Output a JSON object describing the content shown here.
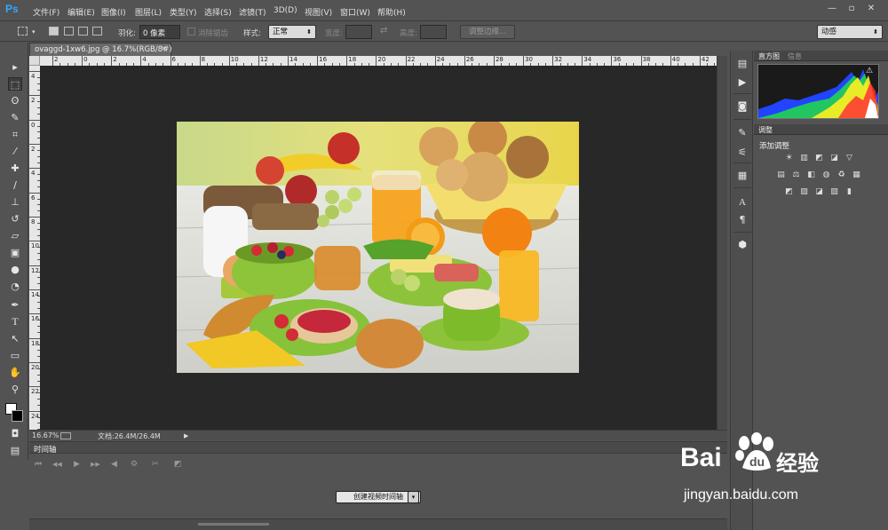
{
  "app": {
    "logo": "Ps"
  },
  "menu": [
    "文件(F)",
    "编辑(E)",
    "图像(I)",
    "图层(L)",
    "类型(Y)",
    "选择(S)",
    "滤镜(T)",
    "3D(D)",
    "视图(V)",
    "窗口(W)",
    "帮助(H)"
  ],
  "window_controls": {
    "minimize": "—",
    "restore": "▫",
    "close": "✕"
  },
  "options": {
    "feather_label": "羽化:",
    "feather_value": "0 像素",
    "antialias_label": "消除锯齿",
    "style_label": "样式:",
    "style_value": "正常",
    "width_label": "宽度:",
    "height_label": "高度:",
    "refine_edge": "调整边缘...",
    "workspace": "动感"
  },
  "document": {
    "tab_title": "ovaggd-1xw6.jpg @ 16.7%(RGB/8#)",
    "close": "×"
  },
  "ruler": {
    "top_labels": [
      "2",
      "0",
      "2",
      "4",
      "6",
      "8",
      "10",
      "12",
      "14",
      "16",
      "18",
      "20",
      "22",
      "24",
      "26",
      "28",
      "30",
      "32",
      "34",
      "36",
      "38",
      "40",
      "42"
    ],
    "left_labels": [
      "4",
      "2",
      "0",
      "2",
      "4",
      "6",
      "8",
      "10",
      "12",
      "14",
      "16",
      "18",
      "20",
      "22",
      "24"
    ]
  },
  "status": {
    "zoom": "16.67%",
    "doc_size": "文档:26.4M/26.4M",
    "arrow": "▶"
  },
  "timeline": {
    "title": "时间轴",
    "create_button": "创建视频时间轴",
    "dropdown_arrow": "▾",
    "controls": [
      "⏮",
      "◀◀",
      "▶",
      "▶▶",
      "◀",
      "⚙",
      "✂",
      "◩"
    ]
  },
  "panels": {
    "tab_histogram": "直方图",
    "tab_info": "信息",
    "tab_adjustments": "调整",
    "adjust_title": "添加调整",
    "warning": "⚠"
  },
  "watermark": {
    "bai": "Bai",
    "du": "du",
    "cn": "经验",
    "url": "jingyan.baidu.com"
  },
  "colors": {
    "accent": "#31a8ff",
    "panel_bg": "#535353",
    "canvas_bg": "#282828"
  }
}
